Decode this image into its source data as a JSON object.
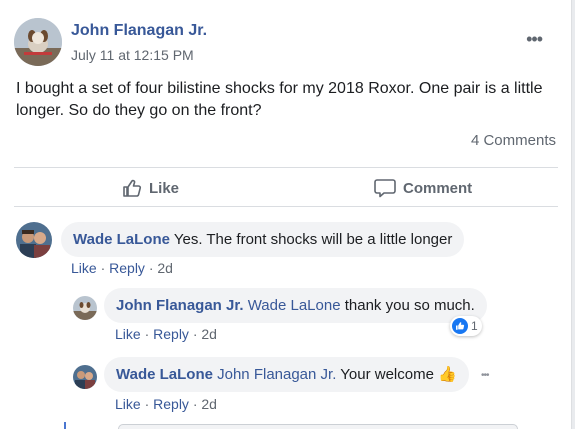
{
  "post": {
    "author": "John Flanagan Jr.",
    "time": "July 11 at 12:15 PM",
    "body": "I bought a set of four bilistine shocks for my 2018 Roxor. One pair is a little longer. So do they go on the front?",
    "comment_count": "4 Comments",
    "more_icon": "•••"
  },
  "actions": {
    "like_label": "Like",
    "comment_label": "Comment"
  },
  "comments": [
    {
      "author": "Wade LaLone",
      "mention": "",
      "text": "Yes. The front shocks will be a little longer",
      "like": "Like",
      "reply": "Reply",
      "age": "2d"
    },
    {
      "author": "John Flanagan Jr.",
      "mention": "Wade LaLone",
      "text": "thank you so much.",
      "like": "Like",
      "reply": "Reply",
      "age": "2d",
      "reaction_count": "1"
    },
    {
      "author": "Wade LaLone",
      "mention": "John Flanagan Jr.",
      "text": "Your welcome",
      "emoji": "👍",
      "like": "Like",
      "reply": "Reply",
      "age": "2d",
      "more_icon": "•••"
    }
  ],
  "colors": {
    "link": "#385898",
    "muted": "#606770",
    "bubble": "#f2f3f5",
    "reaction_blue": "#1877f2"
  },
  "icons": {
    "like": "thumbs-up-icon",
    "comment": "speech-bubble-icon",
    "reaction": "like-reaction-icon",
    "more": "more-options-icon"
  }
}
